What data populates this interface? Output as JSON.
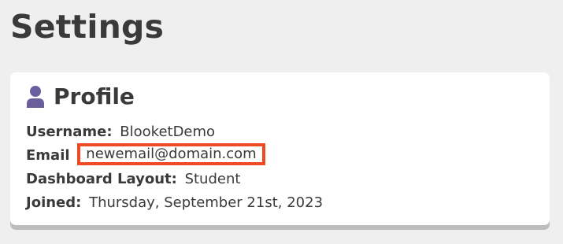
{
  "page": {
    "title": "Settings"
  },
  "profile": {
    "title": "Profile",
    "icon": "user-icon",
    "icon_color": "#6b5e9c",
    "highlight_color": "#ef4b22",
    "rows": [
      {
        "label": "Username:",
        "value": "BlooketDemo"
      },
      {
        "label": "Email",
        "value": "newemail@domain.com"
      },
      {
        "label": "Dashboard Layout:",
        "value": "Student"
      },
      {
        "label": "Joined:",
        "value": "Thursday, September 21st, 2023"
      }
    ]
  }
}
